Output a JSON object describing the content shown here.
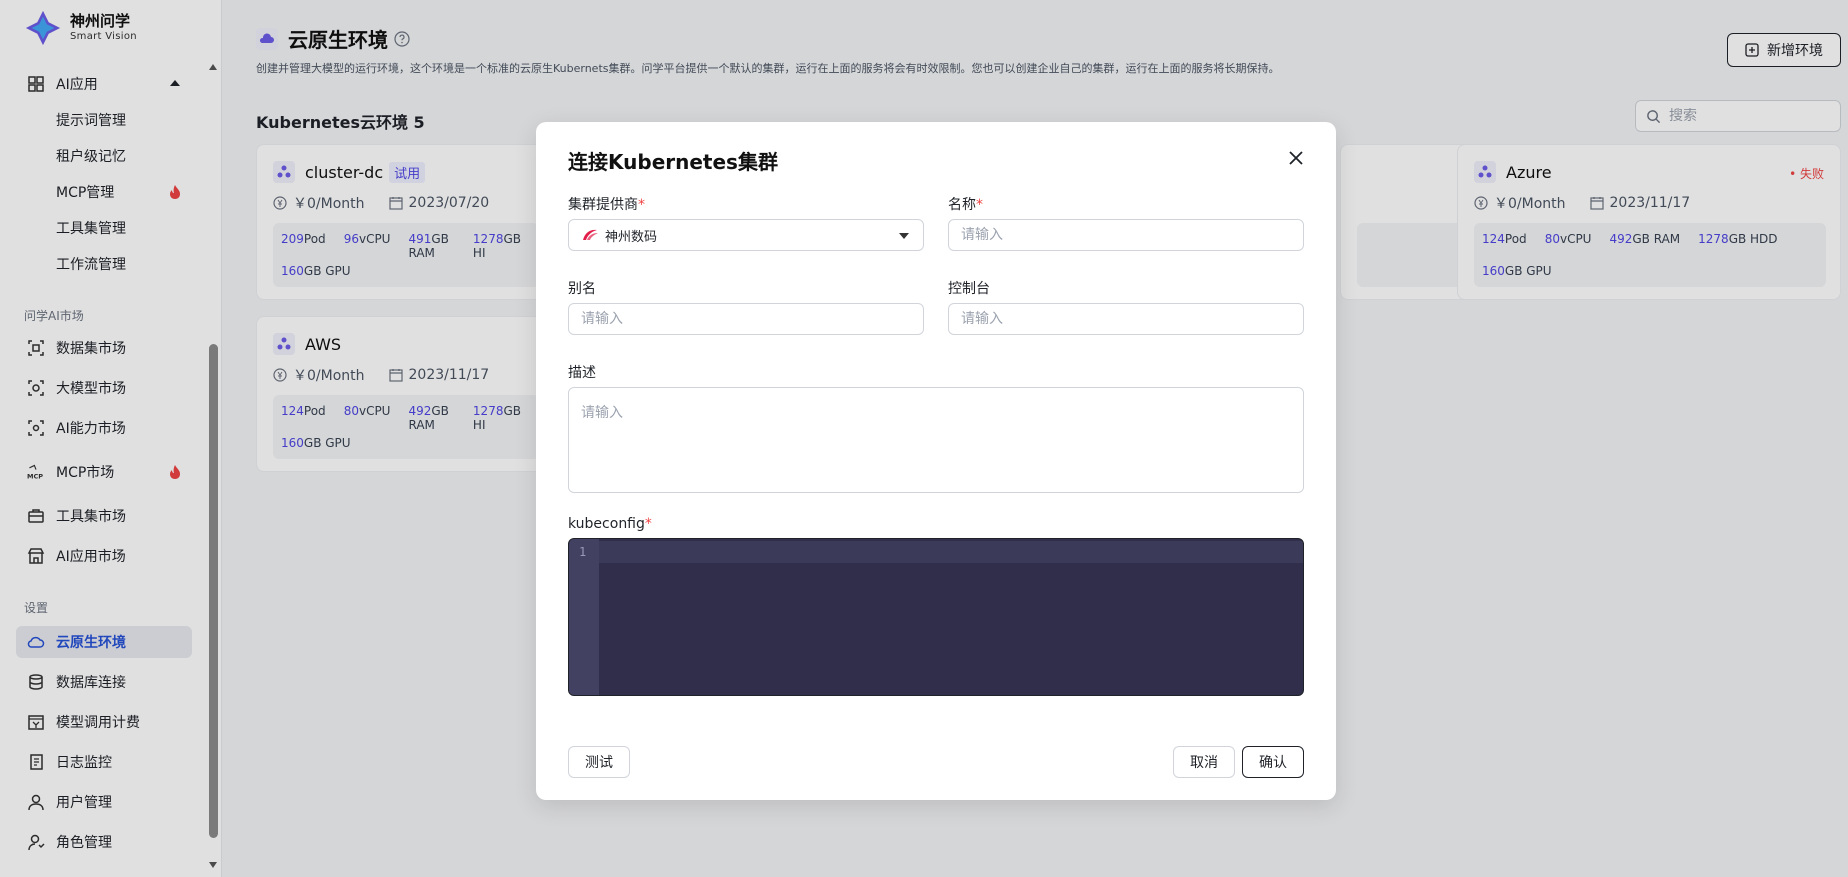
{
  "brand": {
    "name_cn": "神州问学",
    "name_en": "Smart Vision"
  },
  "sidebar": {
    "ai_app": "AI应用",
    "ai_app_children": [
      "提示词管理",
      "租户级记忆",
      "MCP管理",
      "工具集管理",
      "工作流管理"
    ],
    "market_group": "问学AI市场",
    "market_items": [
      "数据集市场",
      "大模型市场",
      "AI能力市场",
      "MCP市场",
      "工具集市场",
      "AI应用市场"
    ],
    "settings_group": "设置",
    "settings_items": [
      "云原生环境",
      "数据库连接",
      "模型调用计费",
      "日志监控",
      "用户管理",
      "角色管理"
    ],
    "active_item": "云原生环境"
  },
  "page": {
    "title": "云原生环境",
    "description": "创建并管理大模型的运行环境，这个环境是一个标准的云原生Kubernets集群。问学平台提供一个默认的集群，运行在上面的服务将会有时效限制。您也可以创建企业自己的集群，运行在上面的服务将长期保持。",
    "add_button": "新增环境",
    "section_title": "Kubernetes云环境 5",
    "search_placeholder": "搜索"
  },
  "clusters": [
    {
      "name": "cluster-dc",
      "tag": "试用",
      "price": "￥0/Month",
      "date": "2023/07/20",
      "pod": "209",
      "vcpu": "96",
      "ram": "491",
      "hdd": "1278",
      "gpu": "160"
    },
    {
      "name": "Azure",
      "status": "失败",
      "price": "￥0/Month",
      "date": "2023/11/17",
      "pod": "124",
      "vcpu": "80",
      "ram": "492",
      "hdd": "1278",
      "gpu": "160"
    },
    {
      "name": "AWS",
      "price": "￥0/Month",
      "date": "2023/11/17",
      "pod": "124",
      "vcpu": "80",
      "ram": "492",
      "hdd": "1278",
      "gpu": "160"
    },
    {
      "status": "失败",
      "hdd_suffix": "DD"
    }
  ],
  "units": {
    "pod": "Pod",
    "vcpu": "vCPU",
    "ram": "GB RAM",
    "hdd": "GB HDD",
    "gpu": "GB GPU",
    "hdd_trunc": "GB HI"
  },
  "modal": {
    "title": "连接Kubernetes集群",
    "provider_label": "集群提供商",
    "provider_value": "神州数码",
    "name_label": "名称",
    "alias_label": "别名",
    "console_label": "控制台",
    "desc_label": "描述",
    "kubeconfig_label": "kubeconfig",
    "placeholder": "请输入",
    "line_number": "1",
    "required_mark": "*",
    "test_button": "测试",
    "cancel_button": "取消",
    "confirm_button": "确认"
  },
  "colors": {
    "accent": "#4f46e5",
    "active_nav": "#2651d6",
    "error": "#ef4444",
    "editor_bg": "#302e4a"
  }
}
